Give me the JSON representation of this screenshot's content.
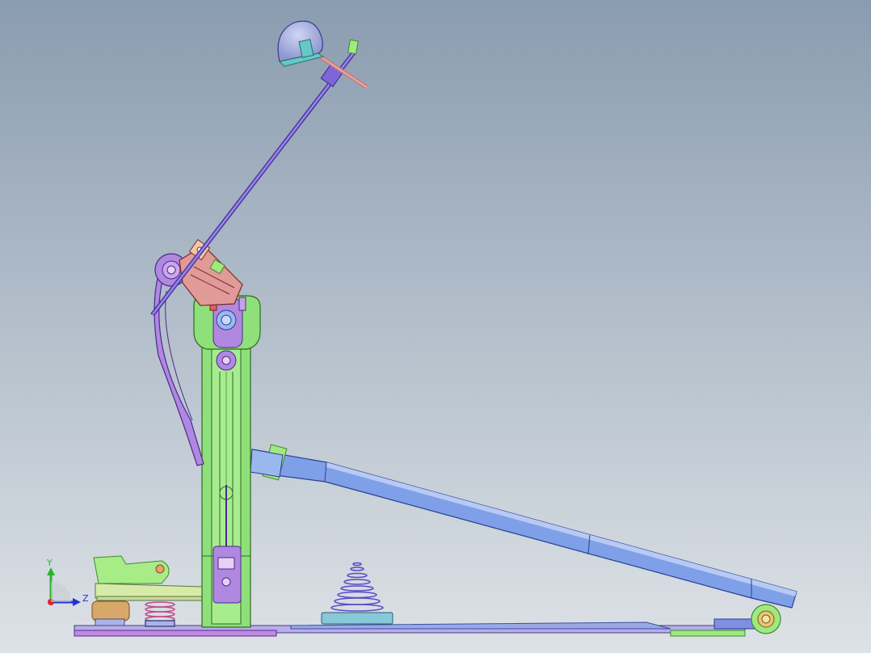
{
  "viewport": {
    "background_top": "#8a9cb0",
    "background_bottom": "#dde2e6"
  },
  "triad": {
    "y_label": "Y",
    "z_label": "Z",
    "x_color": "#e0202a",
    "y_color": "#2bb32b",
    "z_color": "#2230d8"
  },
  "model": {
    "name": "bass drum pedal",
    "colors": {
      "post": "#8fe07a",
      "post_dark": "#3d8a2e",
      "footboard": "#7fa0e8",
      "footboard_dark": "#3a4fa0",
      "beater_shaft": "#7c66d8",
      "beater_head": "#a9b4e4",
      "beater_cap": "#66c8c8",
      "linkage": "#b088e0",
      "cam": "#e09a98",
      "base_plate": "#c08ae0",
      "spring": "#8a7ce0",
      "clamp": "#a0e880",
      "wood_block": "#d8a868"
    }
  }
}
